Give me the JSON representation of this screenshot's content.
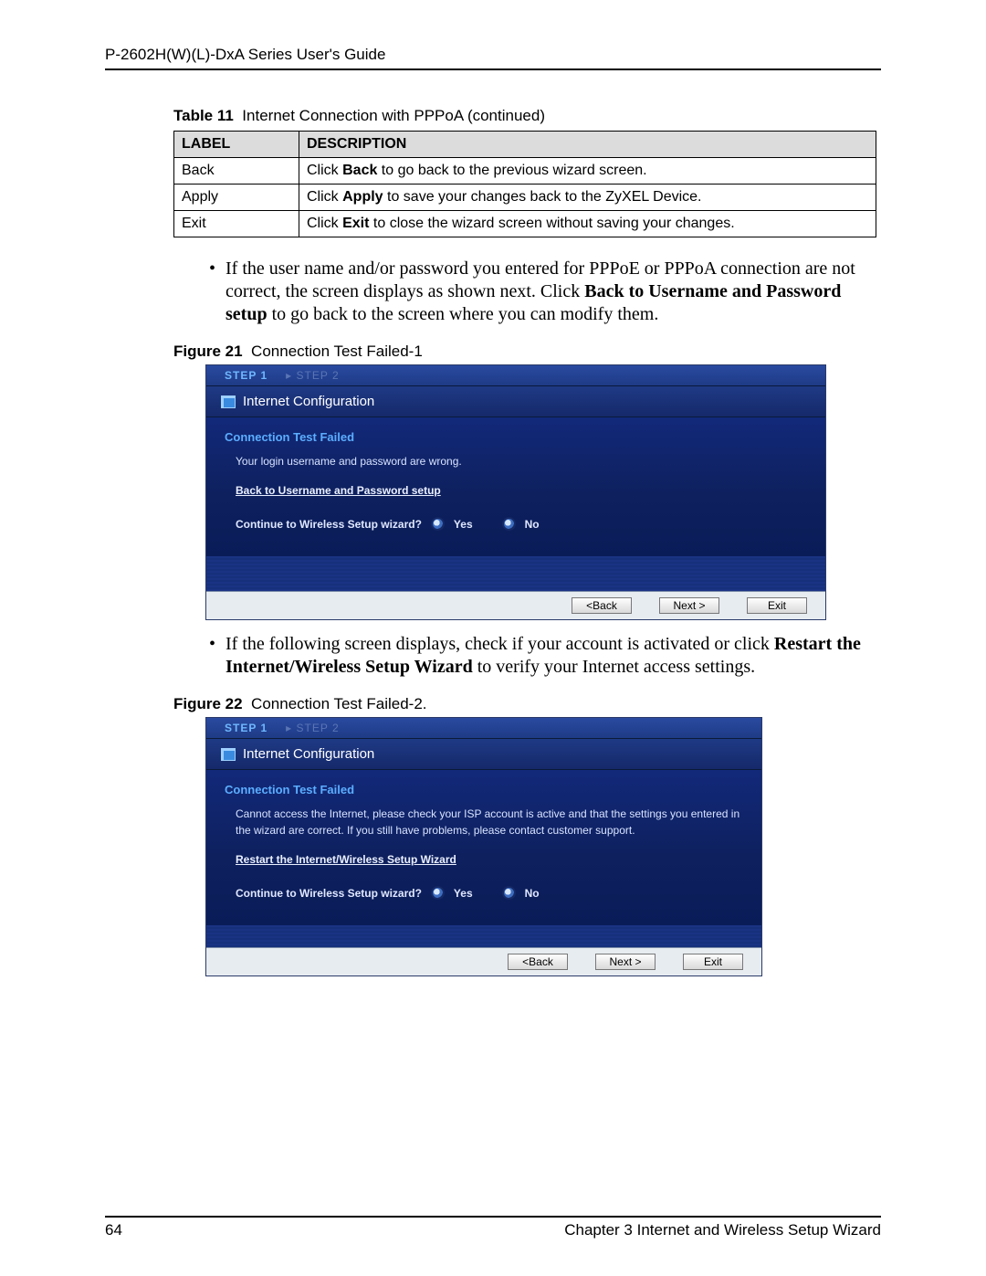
{
  "header": {
    "title": "P-2602H(W)(L)-DxA Series User's Guide"
  },
  "table11": {
    "caption_label": "Table 11",
    "caption_text": "Internet Connection with PPPoA (continued)",
    "headers": {
      "label": "LABEL",
      "description": "DESCRIPTION"
    },
    "rows": [
      {
        "label": "Back",
        "pre": "Click ",
        "bold": "Back",
        "post": " to go back to the previous wizard screen."
      },
      {
        "label": "Apply",
        "pre": "Click ",
        "bold": "Apply",
        "post": " to save your changes back to the ZyXEL Device."
      },
      {
        "label": "Exit",
        "pre": "Click ",
        "bold": "Exit",
        "post": " to close the wizard screen without saving your changes."
      }
    ]
  },
  "bullet1": {
    "pre": "If the user name and/or password you entered for PPPoE or PPPoA connection are not correct, the screen displays as shown next. Click ",
    "bold1": "Back to Username and Password setup",
    "post": " to go back to the screen where you can modify them."
  },
  "figure21": {
    "label": "Figure 21",
    "text": "Connection Test Failed-1"
  },
  "wizard_common": {
    "step1": "STEP 1",
    "step2": "STEP 2",
    "title": "Internet Configuration",
    "fail": "Connection Test Failed",
    "continue": "Continue to Wireless Setup wizard?",
    "yes": "Yes",
    "no": "No",
    "back": "<Back",
    "next": "Next >",
    "exit": "Exit"
  },
  "wizard1": {
    "msg": "Your login username and password are wrong.",
    "link": "Back to Username and Password setup"
  },
  "bullet2": {
    "pre": "If the following screen displays, check if your account is activated or click ",
    "bold1": "Restart the Internet/Wireless Setup Wizard",
    "post": " to verify your Internet access settings."
  },
  "figure22": {
    "label": "Figure 22",
    "text": "Connection Test Failed-2."
  },
  "wizard2": {
    "msg": "Cannot access the Internet, please check your ISP account is active and that the settings you entered in the wizard are correct. If you still have problems, please contact customer support.",
    "link": "Restart the Internet/Wireless Setup Wizard"
  },
  "footer": {
    "page": "64",
    "chapter": "Chapter 3 Internet and Wireless Setup Wizard"
  }
}
